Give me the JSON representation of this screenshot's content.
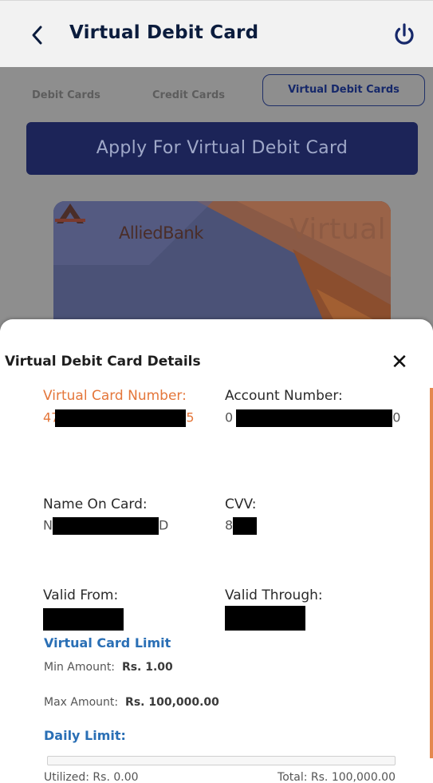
{
  "header": {
    "title": "Virtual Debit Card",
    "back_icon": "chevron-left-icon",
    "power_icon": "power-icon"
  },
  "tabs": [
    {
      "label": "Debit Cards",
      "active": false
    },
    {
      "label": "Credit Cards",
      "active": false
    },
    {
      "label": "Virtual Debit Cards",
      "active": true
    }
  ],
  "apply_button": "Apply For Virtual Debit Card",
  "card": {
    "brand": "AlliedBank",
    "type_label": "Virtual"
  },
  "details": {
    "title": "Virtual Debit Card Details",
    "close_icon": "close-icon",
    "fields": [
      {
        "label": "Virtual Card Number:",
        "value_prefix": "47",
        "value_suffix": "5"
      },
      {
        "label": "Account Number:",
        "value_prefix": "0",
        "value_suffix": "0"
      },
      {
        "label": "Name On Card:",
        "value_prefix": "N",
        "value_suffix": "D"
      },
      {
        "label": "CVV:",
        "value_prefix": "8",
        "value_suffix": ""
      },
      {
        "label": "Valid From:",
        "value_prefix": "",
        "value_suffix": ""
      },
      {
        "label": "Valid Through:",
        "value_prefix": "",
        "value_suffix": ""
      }
    ]
  },
  "limits": {
    "title": "Virtual Card Limit",
    "min_label": "Min Amount:",
    "min_value": "Rs. 1.00",
    "max_label": "Max Amount:",
    "max_value": "Rs. 100,000.00",
    "daily_title": "Daily Limit:",
    "utilized": "Utilized: Rs. 0.00",
    "total": "Total: Rs. 100,000.00",
    "progress_fraction": 0
  },
  "colors": {
    "accent_orange": "#e4763a",
    "navy": "#1c2458",
    "link_blue": "#2a6fb5"
  }
}
